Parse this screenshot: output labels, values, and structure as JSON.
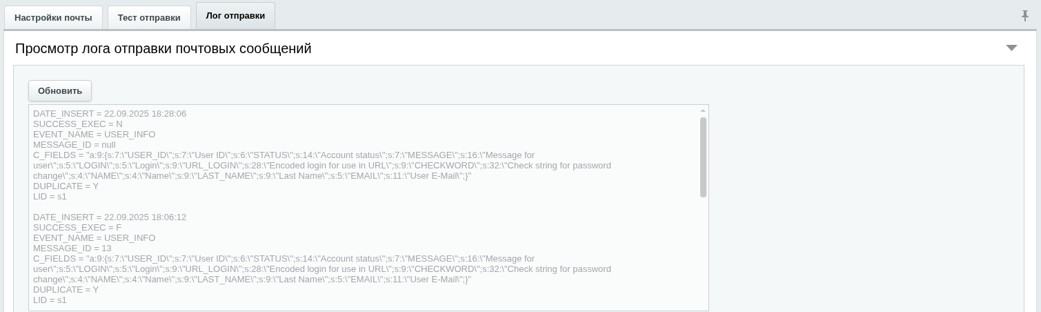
{
  "tabs": [
    {
      "label": "Настройки почты",
      "selected": false
    },
    {
      "label": "Тест отправки",
      "selected": false
    },
    {
      "label": "Лог отправки",
      "selected": true
    }
  ],
  "section": {
    "title": "Просмотр лога отправки почтовых сообщений",
    "expanded": true
  },
  "refresh_button": "Обновить",
  "log": {
    "entries": [
      {
        "lines": [
          "DATE_INSERT = 22.09.2025 18:28:06",
          "SUCCESS_EXEC = N",
          "EVENT_NAME = USER_INFO",
          "MESSAGE_ID = null",
          "C_FIELDS = \"a:9:{s:7:\\\"USER_ID\\\";s:7:\\\"User ID\\\";s:6:\\\"STATUS\\\";s:14:\\\"Account status\\\";s:7:\\\"MESSAGE\\\";s:16:\\\"Message for",
          "user\\\";s:5:\\\"LOGIN\\\";s:5:\\\"Login\\\";s:9:\\\"URL_LOGIN\\\";s:28:\\\"Encoded login for use in URL\\\";s:9:\\\"CHECKWORD\\\";s:32:\\\"Check string for password",
          "change\\\";s:4:\\\"NAME\\\";s:4:\\\"Name\\\";s:9:\\\"LAST_NAME\\\";s:9:\\\"Last Name\\\";s:5:\\\"EMAIL\\\";s:11:\\\"User E-Mail\\\";}\"",
          "DUPLICATE = Y",
          "LID = s1"
        ]
      },
      {
        "lines": [
          "DATE_INSERT = 22.09.2025 18:06:12",
          "SUCCESS_EXEC = F",
          "EVENT_NAME = USER_INFO",
          "MESSAGE_ID = 13",
          "C_FIELDS = \"a:9:{s:7:\\\"USER_ID\\\";s:7:\\\"User ID\\\";s:6:\\\"STATUS\\\";s:14:\\\"Account status\\\";s:7:\\\"MESSAGE\\\";s:16:\\\"Message for",
          "user\\\";s:5:\\\"LOGIN\\\";s:5:\\\"Login\\\";s:9:\\\"URL_LOGIN\\\";s:28:\\\"Encoded login for use in URL\\\";s:9:\\\"CHECKWORD\\\";s:32:\\\"Check string for password",
          "change\\\";s:4:\\\"NAME\\\";s:4:\\\"Name\\\";s:9:\\\"LAST_NAME\\\";s:9:\\\"Last Name\\\";s:5:\\\"EMAIL\\\";s:11:\\\"User E-Mail\\\";}\"",
          "DUPLICATE = Y",
          "LID = s1"
        ]
      }
    ]
  }
}
